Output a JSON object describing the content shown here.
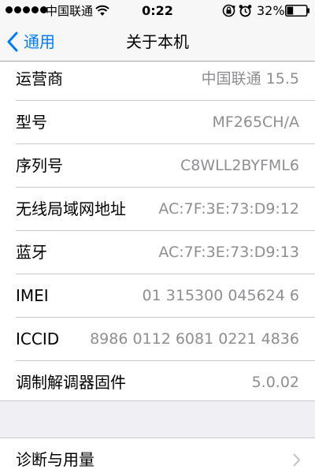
{
  "status_bar": {
    "carrier": "中国联通",
    "time": "0:22",
    "battery_percent": "32%",
    "signal_bars": 5,
    "battery_level": 0.32
  },
  "nav": {
    "back_label": "通用",
    "title": "关于本机"
  },
  "rows": [
    {
      "label": "运营商",
      "value": "中国联通 15.5"
    },
    {
      "label": "型号",
      "value": "MF265CH/A"
    },
    {
      "label": "序列号",
      "value": "C8WLL2BYFML6"
    },
    {
      "label": "无线局域网地址",
      "value": "AC:7F:3E:73:D9:12"
    },
    {
      "label": "蓝牙",
      "value": "AC:7F:3E:73:D9:13"
    },
    {
      "label": "IMEI",
      "value": "01 315300 045624 6"
    },
    {
      "label": "ICCID",
      "value": "8986 0112 6081 0221 4836"
    },
    {
      "label": "调制解调器固件",
      "value": "5.0.02"
    }
  ],
  "diagnostics": {
    "label": "诊断与用量"
  },
  "colors": {
    "accent": "#007aff",
    "value_gray": "#8e8e93",
    "background": "#efeff4"
  }
}
